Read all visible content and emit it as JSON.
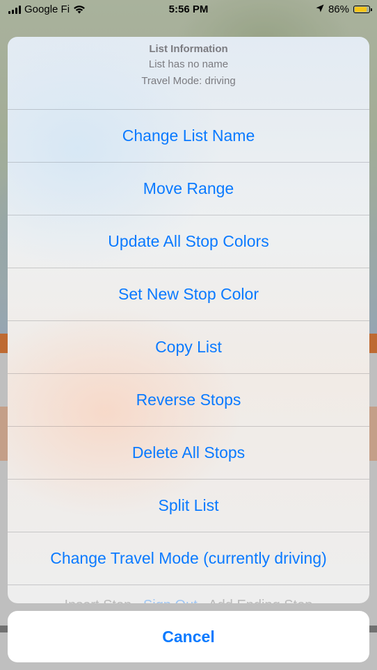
{
  "status_bar": {
    "carrier": "Google Fi",
    "time": "5:56 PM",
    "battery": "86%",
    "battery_level": 0.86,
    "icons": [
      "signal-icon",
      "wifi-icon",
      "location-arrow-icon",
      "battery-icon"
    ]
  },
  "action_sheet": {
    "title": "List Information",
    "subtitle_name": "List has no name",
    "subtitle_mode": "Travel Mode: driving",
    "items": [
      {
        "label": "Change List Name"
      },
      {
        "label": "Move Range"
      },
      {
        "label": "Update All Stop Colors"
      },
      {
        "label": "Set New Stop Color"
      },
      {
        "label": "Copy List"
      },
      {
        "label": "Reverse Stops"
      },
      {
        "label": "Delete All Stops"
      },
      {
        "label": "Split List"
      },
      {
        "label": "Change Travel Mode (currently driving)"
      }
    ],
    "cutoff_row": {
      "left": "Insert Stop",
      "middle": "Sign Out",
      "right": "Add Ending Stop"
    },
    "cancel_label": "Cancel"
  },
  "colors": {
    "action_blue": "#0a7aff",
    "header_gray": "#7b7b80",
    "route_orange": "#e8823e",
    "battery_yellow": "#f5c518"
  }
}
